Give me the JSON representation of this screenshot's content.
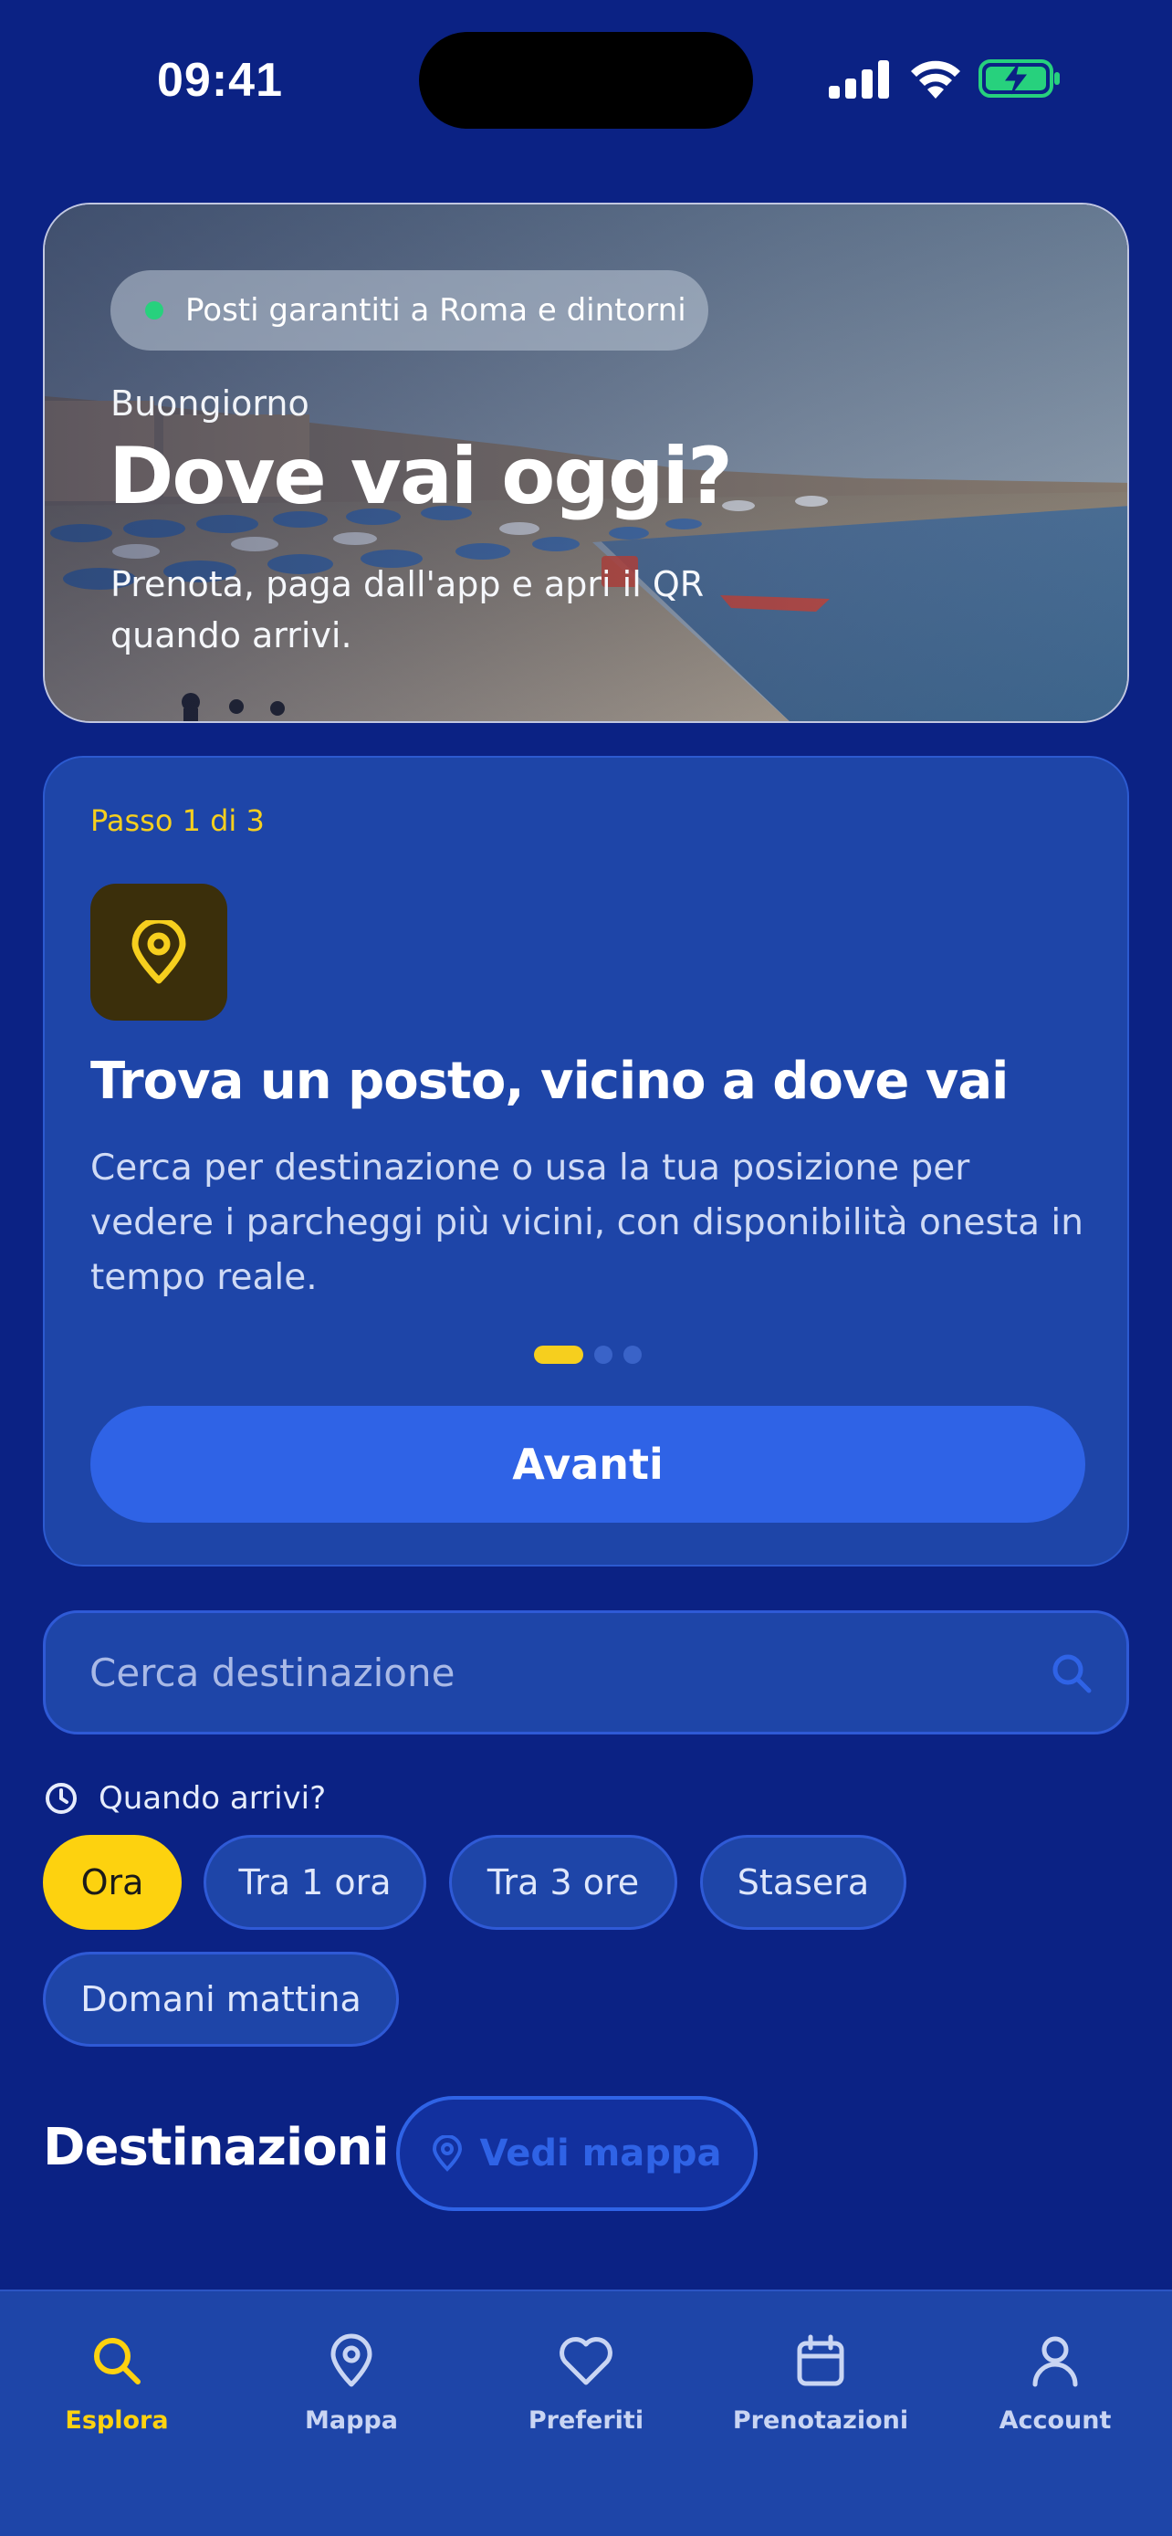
{
  "status_bar": {
    "time": "09:41"
  },
  "hero": {
    "badge": "Posti garantiti a Roma e dintorni",
    "greeting": "Buongiorno",
    "title": "Dove vai oggi?",
    "subtitle": "Prenota, paga dall'app e apri il QR quando arrivi."
  },
  "onboarding": {
    "step": "Passo 1 di 3",
    "title": "Trova un posto, vicino a dove vai",
    "description": "Cerca per destinazione o usa la tua posizione per vedere i parcheggi più vicini, con disponibilità onesta in tempo reale.",
    "current_page": 1,
    "total_pages": 3,
    "next_label": "Avanti"
  },
  "search": {
    "placeholder": "Cerca destinazione"
  },
  "when": {
    "label": "Quando arrivi?",
    "options": [
      "Ora",
      "Tra 1 ora",
      "Tra 3 ore",
      "Stasera",
      "Domani mattina"
    ],
    "selected": "Ora"
  },
  "destinations": {
    "title": "Destinazioni",
    "map_label": "Vedi mappa"
  },
  "tabbar": {
    "items": [
      {
        "label": "Esplora",
        "icon": "search-icon",
        "active": true
      },
      {
        "label": "Mappa",
        "icon": "map-pin-icon",
        "active": false
      },
      {
        "label": "Preferiti",
        "icon": "heart-icon",
        "active": false
      },
      {
        "label": "Prenotazioni",
        "icon": "calendar-icon",
        "active": false
      },
      {
        "label": "Account",
        "icon": "user-icon",
        "active": false
      }
    ]
  },
  "colors": {
    "background": "#0b2284",
    "card": "#1e45a8",
    "accent_yellow": "#fdd20f",
    "primary_blue": "#2f63e6",
    "status_green": "#27d17d"
  }
}
